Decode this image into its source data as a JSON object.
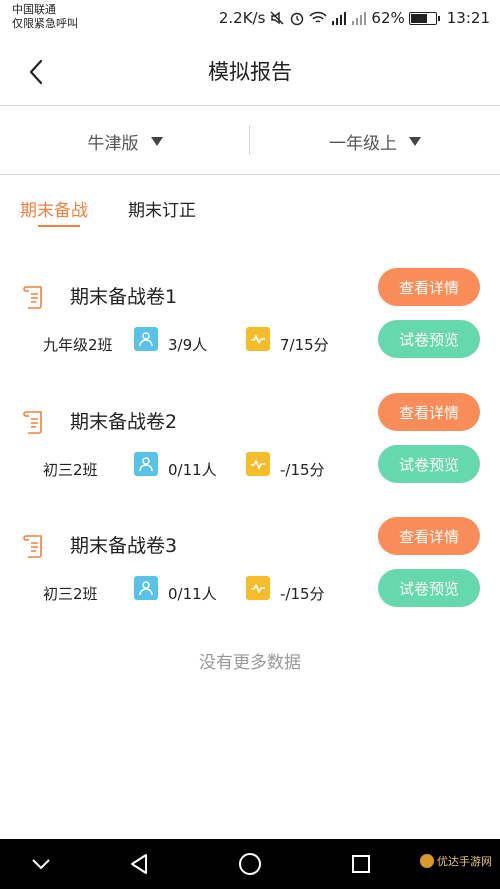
{
  "status_bar": {
    "carrier_line1": "中国联通",
    "carrier_line2": "仅限紧急呼叫",
    "speed": "2.2K/s",
    "battery": "62%",
    "time": "13:21"
  },
  "header": {
    "title": "模拟报告"
  },
  "filters": [
    {
      "label": "牛津版"
    },
    {
      "label": "一年级上"
    }
  ],
  "tabs": [
    {
      "label": "期末备战",
      "active": true
    },
    {
      "label": "期末订正",
      "active": false
    }
  ],
  "papers": [
    {
      "name": "期末备战卷1",
      "class": "九年级2班",
      "people": "3/9人",
      "score": "7/15分",
      "detail_label": "查看详情",
      "preview_label": "试卷预览"
    },
    {
      "name": "期末备战卷2",
      "class": "初三2班",
      "people": "0/11人",
      "score": "-/15分",
      "detail_label": "查看详情",
      "preview_label": "试卷预览"
    },
    {
      "name": "期末备战卷3",
      "class": "初三2班",
      "people": "0/11人",
      "score": "-/15分",
      "detail_label": "查看详情",
      "preview_label": "试卷预览"
    }
  ],
  "footer_text": "没有更多数据",
  "watermark": "优达手游网",
  "colors": {
    "accent": "#f0813e",
    "detail_button": "#f88d5a",
    "preview_button": "#66d8ad",
    "people_icon": "#58c3e6",
    "score_icon": "#f6bd2b"
  }
}
